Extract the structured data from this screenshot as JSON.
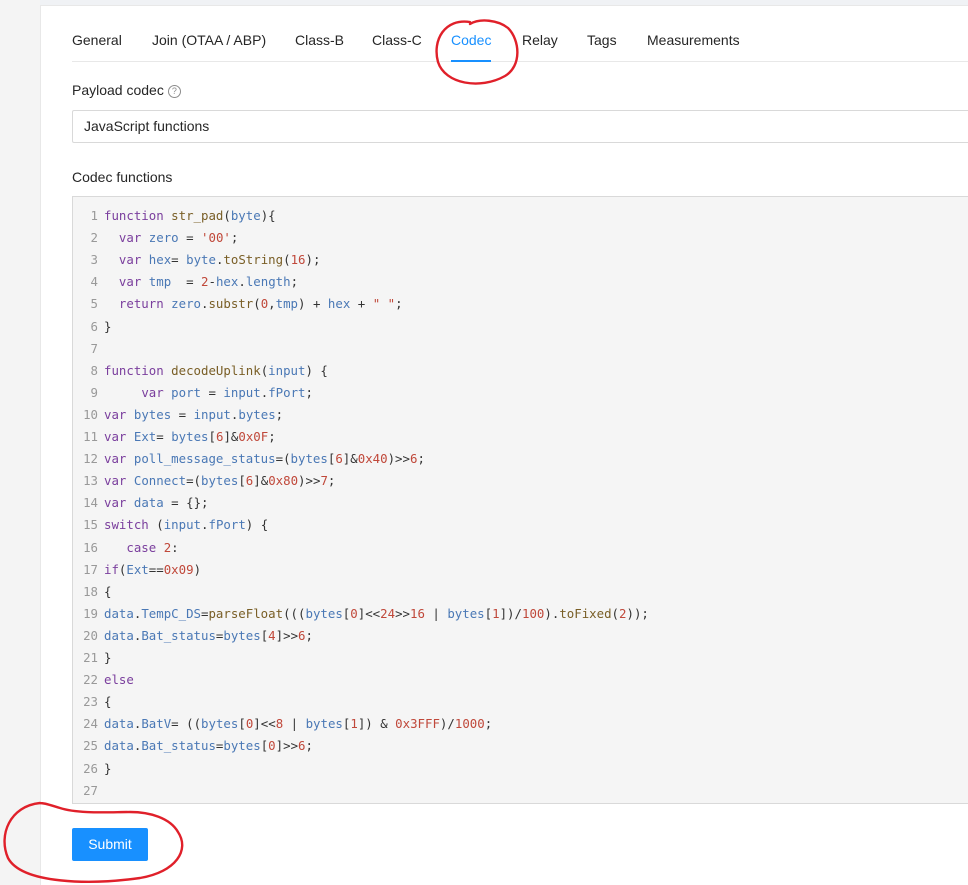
{
  "tabs": [
    {
      "label": "General"
    },
    {
      "label": "Join (OTAA / ABP)"
    },
    {
      "label": "Class-B"
    },
    {
      "label": "Class-C"
    },
    {
      "label": "Codec"
    },
    {
      "label": "Relay"
    },
    {
      "label": "Tags"
    },
    {
      "label": "Measurements"
    }
  ],
  "active_tab": "Codec",
  "payload_codec": {
    "label": "Payload codec",
    "help_icon": "question-circle-icon",
    "selected_value": "JavaScript functions"
  },
  "codec_functions": {
    "label": "Codec functions",
    "lines": [
      {
        "n": "1",
        "text": "function str_pad(byte){"
      },
      {
        "n": "2",
        "text": "  var zero = '00';"
      },
      {
        "n": "3",
        "text": "  var hex= byte.toString(16);"
      },
      {
        "n": "4",
        "text": "  var tmp  = 2-hex.length;"
      },
      {
        "n": "5",
        "text": "  return zero.substr(0,tmp) + hex + \" \";"
      },
      {
        "n": "6",
        "text": "}"
      },
      {
        "n": "7",
        "text": ""
      },
      {
        "n": "8",
        "text": "function decodeUplink(input) {"
      },
      {
        "n": "9",
        "text": "     var port = input.fPort;"
      },
      {
        "n": "10",
        "text": "var bytes = input.bytes;"
      },
      {
        "n": "11",
        "text": "var Ext= bytes[6]&0x0F;"
      },
      {
        "n": "12",
        "text": "var poll_message_status=(bytes[6]&0x40)>>6;"
      },
      {
        "n": "13",
        "text": "var Connect=(bytes[6]&0x80)>>7;"
      },
      {
        "n": "14",
        "text": "var data = {};"
      },
      {
        "n": "15",
        "text": "switch (input.fPort) {"
      },
      {
        "n": "16",
        "text": "   case 2:"
      },
      {
        "n": "17",
        "text": "if(Ext==0x09)"
      },
      {
        "n": "18",
        "text": "{"
      },
      {
        "n": "19",
        "text": "data.TempC_DS=parseFloat(((bytes[0]<<24>>16 | bytes[1])/100).toFixed(2));"
      },
      {
        "n": "20",
        "text": "data.Bat_status=bytes[4]>>6;"
      },
      {
        "n": "21",
        "text": "}"
      },
      {
        "n": "22",
        "text": "else"
      },
      {
        "n": "23",
        "text": "{"
      },
      {
        "n": "24",
        "text": "data.BatV= ((bytes[0]<<8 | bytes[1]) & 0x3FFF)/1000;"
      },
      {
        "n": "25",
        "text": "data.Bat_status=bytes[0]>>6;"
      },
      {
        "n": "26",
        "text": "}"
      },
      {
        "n": "27",
        "text": ""
      }
    ]
  },
  "submit": {
    "label": "Submit"
  },
  "colors": {
    "primary": "#1890ff",
    "annotation": "#e0202a"
  }
}
